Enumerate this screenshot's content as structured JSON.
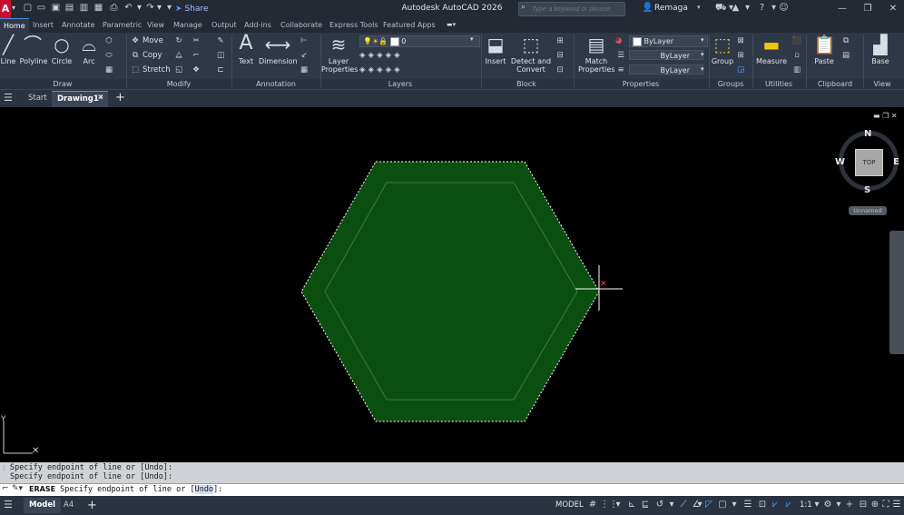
{
  "app": {
    "logo_letter": "A",
    "title": "Autodesk AutoCAD 2026",
    "share_label": "Share",
    "search_placeholder": "Type a keyword or phrase",
    "user_name": "Remaga"
  },
  "ribbon_tabs": [
    "Home",
    "Insert",
    "Annotate",
    "Parametric",
    "View",
    "Manage",
    "Output",
    "Add-ins",
    "Collaborate",
    "Express Tools",
    "Featured Apps"
  ],
  "ribbon": {
    "draw": {
      "title": "Draw",
      "line": "Line",
      "polyline": "Polyline",
      "circle": "Circle",
      "arc": "Arc"
    },
    "modify": {
      "title": "Modify",
      "move": "Move",
      "copy": "Copy",
      "stretch": "Stretch"
    },
    "annotation": {
      "title": "Annotation",
      "text": "Text",
      "dimension": "Dimension"
    },
    "layers": {
      "title": "Layers",
      "layer_properties": "Layer Properties",
      "current_layer": "0"
    },
    "block": {
      "title": "Block",
      "insert": "Insert",
      "detect_convert": "Detect and Convert"
    },
    "properties": {
      "title": "Properties",
      "match": "Match Properties",
      "color": "ByLayer",
      "linetype": "ByLayer",
      "lineweight": "ByLayer"
    },
    "groups": {
      "title": "Groups",
      "group": "Group"
    },
    "utilities": {
      "title": "Utilities",
      "measure": "Measure"
    },
    "clipboard": {
      "title": "Clipboard",
      "paste": "Paste"
    },
    "view": {
      "title": "View",
      "base": "Base"
    }
  },
  "file_tabs": {
    "start": "Start",
    "drawing": "Drawing1*"
  },
  "viewcube": {
    "north": "N",
    "south": "S",
    "east": "E",
    "west": "W",
    "face": "TOP",
    "ucs": "Unnamed"
  },
  "ucs_icon": {
    "y": "Y"
  },
  "command": {
    "history": [
      "Specify endpoint of line or [Undo]:",
      "Specify endpoint of line or [Undo]:"
    ],
    "name": "ERASE",
    "prompt_before": "Specify endpoint of line or [",
    "option": "Undo",
    "prompt_after": "]:"
  },
  "status": {
    "model_tab": "Model",
    "layout_tab": "A4",
    "space": "MODEL",
    "scale": "1:1"
  },
  "colors": {
    "hexagon_fill": "#0b4f10",
    "accent": "#4a90d9",
    "crosshair": "#ffffff",
    "pickbox": "#ff3b3b"
  }
}
